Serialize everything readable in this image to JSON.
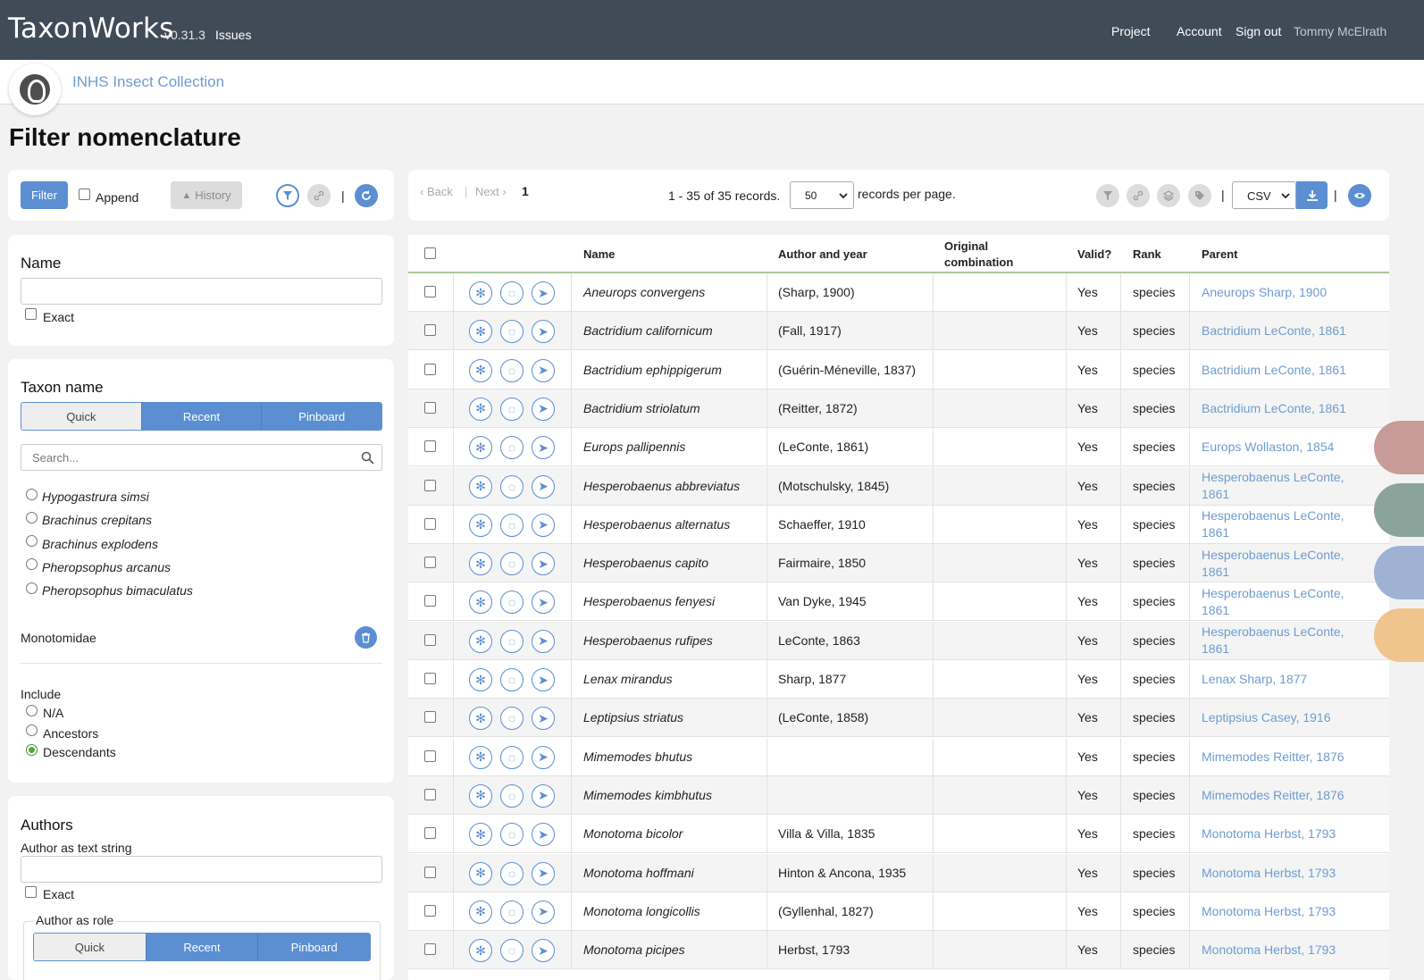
{
  "header": {
    "brand": "TaxonWorks",
    "version": "v0.31.3",
    "issues": "Issues",
    "nav": [
      "Project",
      "Account",
      "Sign out"
    ],
    "user": "Tommy McElrath"
  },
  "project": {
    "name": "INHS Insect Collection",
    "logo_icon": "beetle-logo-icon"
  },
  "page": {
    "title": "Filter nomenclature"
  },
  "toolbar_left": {
    "filter_label": "Filter",
    "append_label": "Append",
    "history_label": "History",
    "separator": "|"
  },
  "name_panel": {
    "title": "Name",
    "exact_label": "Exact",
    "value": ""
  },
  "taxon_panel": {
    "title": "Taxon name",
    "tabs": [
      "Quick",
      "Recent",
      "Pinboard"
    ],
    "active_tabs": [
      "Recent",
      "Pinboard"
    ],
    "search_placeholder": "Search...",
    "options": [
      "Hypogastrura simsi",
      "Brachinus crepitans",
      "Brachinus explodens",
      "Pheropsophus arcanus",
      "Pheropsophus bimaculatus"
    ],
    "selected": "Monotomidae",
    "include_label": "Include",
    "include_options": [
      "N/A",
      "Ancestors",
      "Descendants"
    ],
    "include_selected": "Descendants"
  },
  "authors_panel": {
    "title": "Authors",
    "text_label": "Author as text string",
    "exact_label": "Exact",
    "role_label": "Author as role",
    "tabs": [
      "Quick",
      "Recent",
      "Pinboard"
    ]
  },
  "pagination": {
    "back": "‹ Back",
    "sep": "|",
    "next": "Next ›",
    "page": "1",
    "records": "1 - 35 of 35 records.",
    "per_page": "50",
    "per_page_label": "records per page.",
    "export_format": "CSV",
    "separator": "|"
  },
  "table": {
    "columns": [
      "Name",
      "Author and year",
      "Original\ncombination",
      "Valid?",
      "Rank",
      "Parent"
    ],
    "rows": [
      {
        "name": "Aneurops convergens",
        "author": "(Sharp, 1900)",
        "orig": "",
        "valid": "Yes",
        "rank": "species",
        "parent": "Aneurops Sharp, 1900"
      },
      {
        "name": "Bactridium californicum",
        "author": "(Fall, 1917)",
        "orig": "",
        "valid": "Yes",
        "rank": "species",
        "parent": "Bactridium LeConte, 1861"
      },
      {
        "name": "Bactridium ephippigerum",
        "author": "(Guérin-Méneville, 1837)",
        "orig": "",
        "valid": "Yes",
        "rank": "species",
        "parent": "Bactridium LeConte, 1861"
      },
      {
        "name": "Bactridium striolatum",
        "author": "(Reitter, 1872)",
        "orig": "",
        "valid": "Yes",
        "rank": "species",
        "parent": "Bactridium LeConte, 1861"
      },
      {
        "name": "Europs pallipennis",
        "author": "(LeConte, 1861)",
        "orig": "",
        "valid": "Yes",
        "rank": "species",
        "parent": "Europs Wollaston, 1854"
      },
      {
        "name": "Hesperobaenus abbreviatus",
        "author": "(Motschulsky, 1845)",
        "orig": "",
        "valid": "Yes",
        "rank": "species",
        "parent": "Hesperobaenus LeConte, 1861"
      },
      {
        "name": "Hesperobaenus alternatus",
        "author": "Schaeffer, 1910",
        "orig": "",
        "valid": "Yes",
        "rank": "species",
        "parent": "Hesperobaenus LeConte, 1861"
      },
      {
        "name": "Hesperobaenus capito",
        "author": "Fairmaire, 1850",
        "orig": "",
        "valid": "Yes",
        "rank": "species",
        "parent": "Hesperobaenus LeConte, 1861"
      },
      {
        "name": "Hesperobaenus fenyesi",
        "author": "Van Dyke, 1945",
        "orig": "",
        "valid": "Yes",
        "rank": "species",
        "parent": "Hesperobaenus LeConte, 1861"
      },
      {
        "name": "Hesperobaenus rufipes",
        "author": "LeConte, 1863",
        "orig": "",
        "valid": "Yes",
        "rank": "species",
        "parent": "Hesperobaenus LeConte, 1861"
      },
      {
        "name": "Lenax mirandus",
        "author": "Sharp, 1877",
        "orig": "",
        "valid": "Yes",
        "rank": "species",
        "parent": "Lenax Sharp, 1877"
      },
      {
        "name": "Leptipsius striatus",
        "author": "(LeConte, 1858)",
        "orig": "",
        "valid": "Yes",
        "rank": "species",
        "parent": "Leptipsius Casey, 1916"
      },
      {
        "name": "Mimemodes bhutus",
        "author": "",
        "orig": "",
        "valid": "Yes",
        "rank": "species",
        "parent": "Mimemodes Reitter, 1876"
      },
      {
        "name": "Mimemodes kimbhutus",
        "author": "",
        "orig": "",
        "valid": "Yes",
        "rank": "species",
        "parent": "Mimemodes Reitter, 1876"
      },
      {
        "name": "Monotoma bicolor",
        "author": "Villa & Villa, 1835",
        "orig": "",
        "valid": "Yes",
        "rank": "species",
        "parent": "Monotoma Herbst, 1793"
      },
      {
        "name": "Monotoma hoffmani",
        "author": "Hinton & Ancona, 1935",
        "orig": "",
        "valid": "Yes",
        "rank": "species",
        "parent": "Monotoma Herbst, 1793"
      },
      {
        "name": "Monotoma longicollis",
        "author": "(Gyllenhal, 1827)",
        "orig": "",
        "valid": "Yes",
        "rank": "species",
        "parent": "Monotoma Herbst, 1793"
      },
      {
        "name": "Monotoma picipes",
        "author": "Herbst, 1793",
        "orig": "",
        "valid": "Yes",
        "rank": "species",
        "parent": "Monotoma Herbst, 1793"
      }
    ],
    "row_icons": [
      "radial-annotator-icon",
      "radial-object-icon",
      "navigate-icon"
    ]
  },
  "colors": {
    "accent": "#5b8fd1",
    "header_bg": "#404b58",
    "link": "#6e9cd0"
  }
}
